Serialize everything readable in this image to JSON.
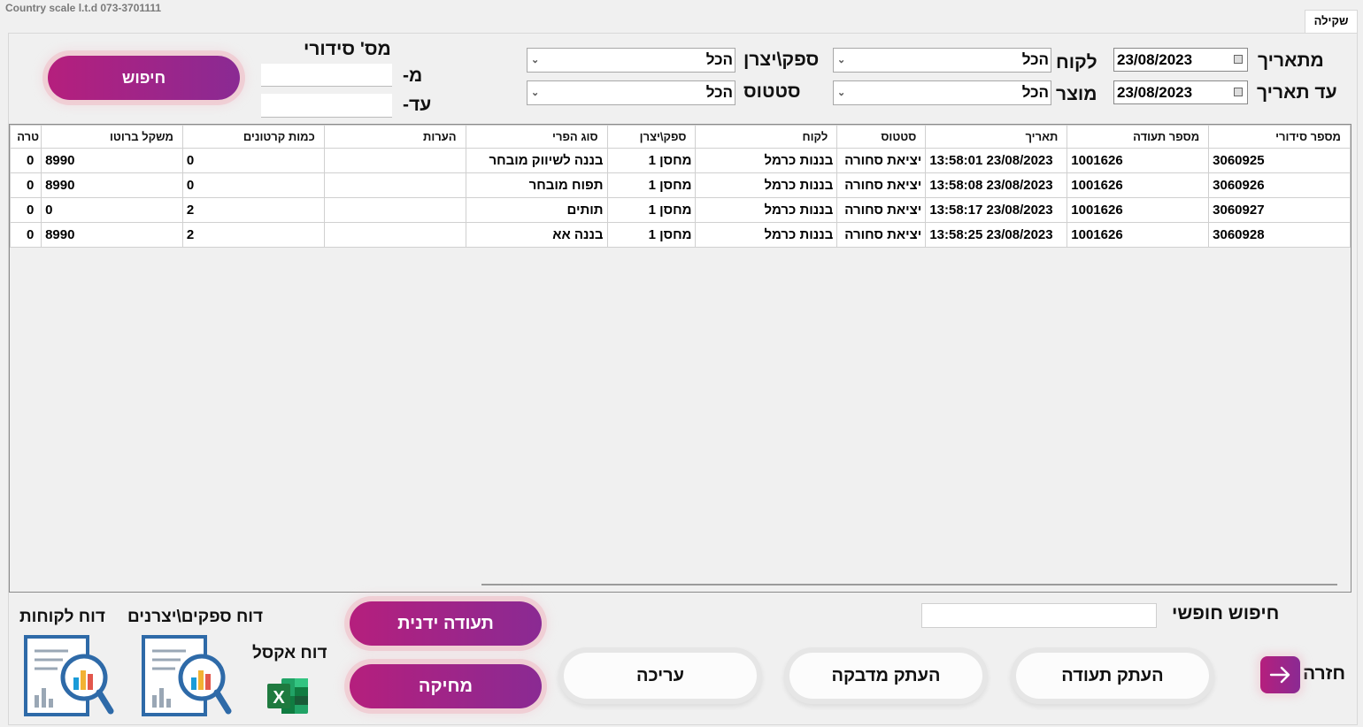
{
  "app": {
    "title": "Country scale l.t.d 073-3701111"
  },
  "tab": {
    "label": "שקילה"
  },
  "filters": {
    "from_date_label": "מתאריך",
    "to_date_label": "עד תאריך",
    "from_date": "23/08/2023",
    "to_date": "23/08/2023",
    "customer_label": "לקוח",
    "customer_value": "הכל",
    "product_label": "מוצר",
    "product_value": "הכל",
    "supplier_label": "ספק\\יצרן",
    "supplier_value": "הכל",
    "status_label": "סטטוס",
    "status_value": "הכל",
    "serial_label": "מס' סידורי",
    "serial_from_label": "מ-",
    "serial_to_label": "עד-",
    "search_button": "חיפוש"
  },
  "table": {
    "columns": [
      "מספר סידורי",
      "מספר תעודה",
      "תאריך",
      "סטטוס",
      "לקוח",
      "ספק\\יצרן",
      "סוג הפרי",
      "הערות",
      "כמות קרטונים",
      "משקל ברוטו",
      "טרה"
    ],
    "rows": [
      [
        "3060925",
        "1001626",
        "23/08/2023 13:58:01",
        "יציאת סחורה",
        "בננות כרמל",
        "מחסן 1",
        "בננה לשיווק מובחר",
        "",
        "0",
        "8990",
        "0"
      ],
      [
        "3060926",
        "1001626",
        "23/08/2023 13:58:08",
        "יציאת סחורה",
        "בננות כרמל",
        "מחסן 1",
        "תפוח מובחר",
        "",
        "0",
        "8990",
        "0"
      ],
      [
        "3060927",
        "1001626",
        "23/08/2023 13:58:17",
        "יציאת סחורה",
        "בננות כרמל",
        "מחסן 1",
        "תותים",
        "",
        "2",
        "0",
        "0"
      ],
      [
        "3060928",
        "1001626",
        "23/08/2023 13:58:25",
        "יציאת סחורה",
        "בננות כרמל",
        "מחסן 1",
        "בננה אא",
        "",
        "2",
        "8990",
        "0"
      ]
    ]
  },
  "bottom": {
    "free_search_label": "חיפוש חופשי",
    "back_label": "חזרה",
    "copy_doc_button": "העתק תעודה",
    "copy_label_button": "העתק מדבקה",
    "edit_button": "עריכה",
    "manual_doc_button": "תעודה ידנית",
    "delete_button": "מחיקה",
    "excel_report_label": "דוח אקסל",
    "suppliers_report_label": "דוח ספקים\\יצרנים",
    "customers_report_label": "דוח לקוחות"
  },
  "colors": {
    "accent_start": "#b51f7d",
    "accent_end": "#8a2a93",
    "excel_green": "#1f7a3f",
    "report_blue": "#2e6aa8"
  }
}
